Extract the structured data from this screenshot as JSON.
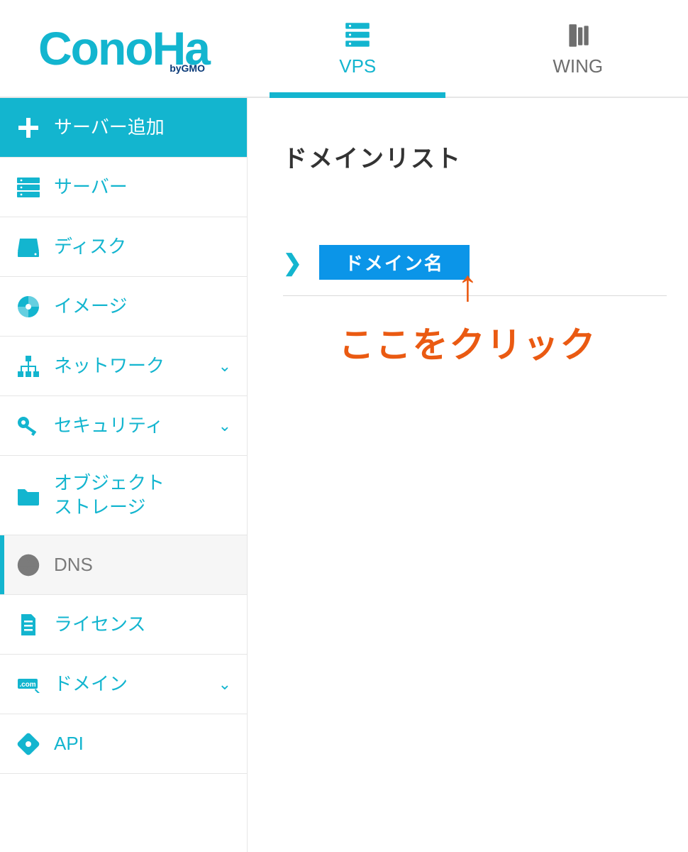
{
  "brand": {
    "name": "ConoHa",
    "byline": "byGMO"
  },
  "tabs": {
    "vps": "VPS",
    "wing": "WING"
  },
  "sidebar": {
    "add_server": "サーバー追加",
    "items": [
      {
        "label": "サーバー"
      },
      {
        "label": "ディスク"
      },
      {
        "label": "イメージ"
      },
      {
        "label": "ネットワーク",
        "expandable": true
      },
      {
        "label": "セキュリティ",
        "expandable": true
      },
      {
        "label": "オブジェクト\nストレージ"
      },
      {
        "label": "DNS",
        "active": true
      },
      {
        "label": "ライセンス"
      },
      {
        "label": "ドメイン",
        "expandable": true
      },
      {
        "label": "API"
      }
    ]
  },
  "main": {
    "page_title": "ドメインリスト",
    "column_header": "ドメイン名"
  },
  "annotation": {
    "text": "ここをクリック"
  },
  "colors": {
    "accent": "#13b5cf",
    "highlight": "#ea5a12",
    "button_blue": "#0b95e8"
  }
}
